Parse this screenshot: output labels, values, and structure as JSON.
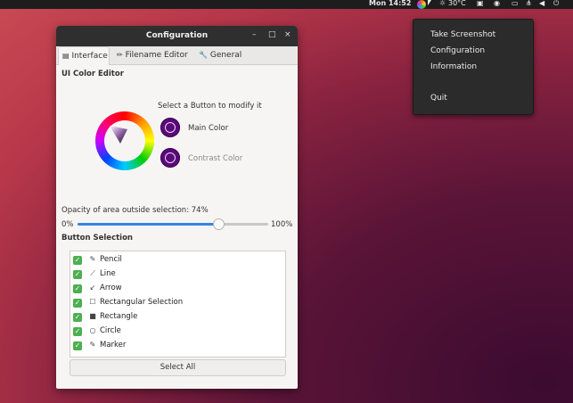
{
  "topbar": {
    "clock": "Mon 14:52",
    "temperature": "30°C",
    "tray_icons": [
      "flameshot-icon",
      "weather-icon",
      "clipboard-icon",
      "bag-icon",
      "display-icon",
      "network-icon",
      "volume-icon",
      "power-icon"
    ]
  },
  "tray_menu": {
    "items": [
      {
        "label": "Take Screenshot"
      },
      {
        "label": "Configuration"
      },
      {
        "label": "Information"
      },
      {
        "label": "Quit"
      }
    ]
  },
  "window": {
    "title": "Configuration",
    "controls": {
      "minimize": "–",
      "maximize": "□",
      "close": "×"
    },
    "tabs": [
      {
        "label": "Interface",
        "active": true
      },
      {
        "label": "Filename Editor",
        "active": false
      },
      {
        "label": "General",
        "active": false
      }
    ],
    "color_editor": {
      "heading": "UI Color Editor",
      "hint": "Select a Button to modify it",
      "main_color_label": "Main Color",
      "contrast_color_label": "Contrast Color",
      "main_color": "#5a0a7a"
    },
    "opacity": {
      "label": "Opacity of area outside selection: 74%",
      "min_label": "0%",
      "max_label": "100%",
      "value_percent": 74
    },
    "button_selection": {
      "heading": "Button Selection",
      "items": [
        {
          "label": "Pencil",
          "icon": "pencil-icon",
          "glyph": "✎",
          "checked": true
        },
        {
          "label": "Line",
          "icon": "line-icon",
          "glyph": "⟋",
          "checked": true
        },
        {
          "label": "Arrow",
          "icon": "arrow-icon",
          "glyph": "↙",
          "checked": true
        },
        {
          "label": "Rectangular Selection",
          "icon": "rect-selection-icon",
          "glyph": "☐",
          "checked": true
        },
        {
          "label": "Rectangle",
          "icon": "rectangle-icon",
          "glyph": "■",
          "checked": true
        },
        {
          "label": "Circle",
          "icon": "circle-icon",
          "glyph": "○",
          "checked": true
        },
        {
          "label": "Marker",
          "icon": "marker-icon",
          "glyph": "✎",
          "checked": true
        }
      ],
      "select_all_label": "Select All"
    }
  }
}
